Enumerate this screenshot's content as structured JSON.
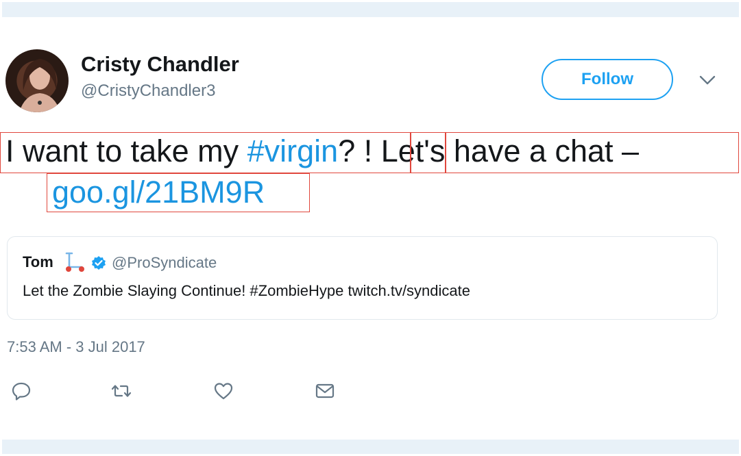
{
  "tweet": {
    "author_name": "Cristy Chandler",
    "author_handle": "@CristyChandler3",
    "follow_label": "Follow",
    "text_part1": "I want to take my ",
    "hashtag": "#virgin",
    "text_part2": "? ! Let's have a chat –",
    "link": "goo.gl/21BM9R",
    "timestamp": "7:53 AM - 3 Jul 2017"
  },
  "quoted_tweet": {
    "author_name": "Tom",
    "author_handle": "@ProSyndicate",
    "text": "Let the Zombie Slaying Continue! #ZombieHype twitch.tv/syndicate"
  },
  "actions": [
    {
      "icon": "reply-icon"
    },
    {
      "icon": "retweet-icon"
    },
    {
      "icon": "like-icon"
    },
    {
      "icon": "message-icon"
    }
  ],
  "colors": {
    "accent": "#1da1f2",
    "link": "#1b95e0",
    "muted": "#657786",
    "annotation": "#e0463c"
  }
}
